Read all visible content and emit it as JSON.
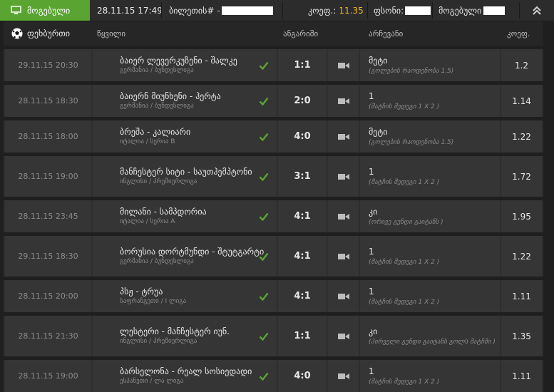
{
  "topbar": {
    "status": "მოგებული",
    "datetime": "28.11.15 17:49",
    "ticket_label": "ბილეთის# -",
    "coef_label": "კოეფ.:",
    "coef_value": "11.35",
    "stake_label": "ფსონი:",
    "payout_label": "მოგებული"
  },
  "header": {
    "sport": "ფეხბურთი",
    "event": "წყვილი",
    "score": "ანგარიში",
    "bet": "არჩევანი",
    "odds": "კოეფ."
  },
  "colors": {
    "accent": "#5aa532",
    "coef": "#f2b52b"
  },
  "rows": [
    {
      "date": "29.11.15 20:30",
      "teams": "ბაიერ ლევერკუზენი - შალკე",
      "league": "გერმანია / ბუნდესლიგა",
      "score": "1:1",
      "bet": "მეტი",
      "desc": "(გოლების რაოდენობა 1.5)",
      "odds": "1.2"
    },
    {
      "date": "28.11.15 18:30",
      "teams": "ბაიერნ მიუნხენი - ჰერტა",
      "league": "გერმანია / ბუნდესლიგა",
      "score": "2:0",
      "bet": "1",
      "desc": "(მატჩის შედეგი 1 X 2 )",
      "odds": "1.14"
    },
    {
      "date": "28.11.15 18:00",
      "teams": "ბრეშა - კალიარი",
      "league": "იტალია / სერია B",
      "score": "4:0",
      "bet": "მეტი",
      "desc": "(გოლების რაოდენობა 1.5)",
      "odds": "1.22"
    },
    {
      "date": "28.11.15 19:00",
      "teams": "მანჩესტერ სიტი - საუთჰემპტონი",
      "league": "ინგლისი / პრემიერლიგა",
      "score": "3:1",
      "bet": "1",
      "desc": "(მატჩის შედეგი 1 X 2 )",
      "odds": "1.72"
    },
    {
      "date": "28.11.15 23:45",
      "teams": "მილანი - სამპდორია",
      "league": "იტალია / სერია A",
      "score": "4:1",
      "bet": "კი",
      "desc": "(ორივე გუნდი გაიტანს )",
      "odds": "1.95"
    },
    {
      "date": "29.11.15 18:30",
      "teams": "ბორუსია დორტმუნდი - შტუტგარტი",
      "league": "გერმანია / ბუნდესლიგა",
      "score": "4:1",
      "bet": "1",
      "desc": "(მატჩის შედეგი 1 X 2 )",
      "odds": "1.22"
    },
    {
      "date": "28.11.15 20:00",
      "teams": "პსჟ - ტრუა",
      "league": "საფრანგეთი / I ლიგა",
      "score": "4:1",
      "bet": "1",
      "desc": "(მატჩის შედეგი 1 X 2 )",
      "odds": "1.11"
    },
    {
      "date": "28.11.15 21:30",
      "teams": "ლესტერი - მანჩესტერ იუნ.",
      "league": "ინგლისი / პრემიერლიგა",
      "score": "1:1",
      "bet": "კი",
      "desc": "(პირველი გუნდი გაიტანს გოლს მატჩში )",
      "odds": "1.35"
    },
    {
      "date": "28.11.15 19:00",
      "teams": "ბარსელონა - რეალ სოსიედადი",
      "league": "ესპანეთი / ლა ლიგა",
      "score": "4:0",
      "bet": "1",
      "desc": "(მატჩის შედეგი 1 X 2 )",
      "odds": "1.11"
    }
  ]
}
